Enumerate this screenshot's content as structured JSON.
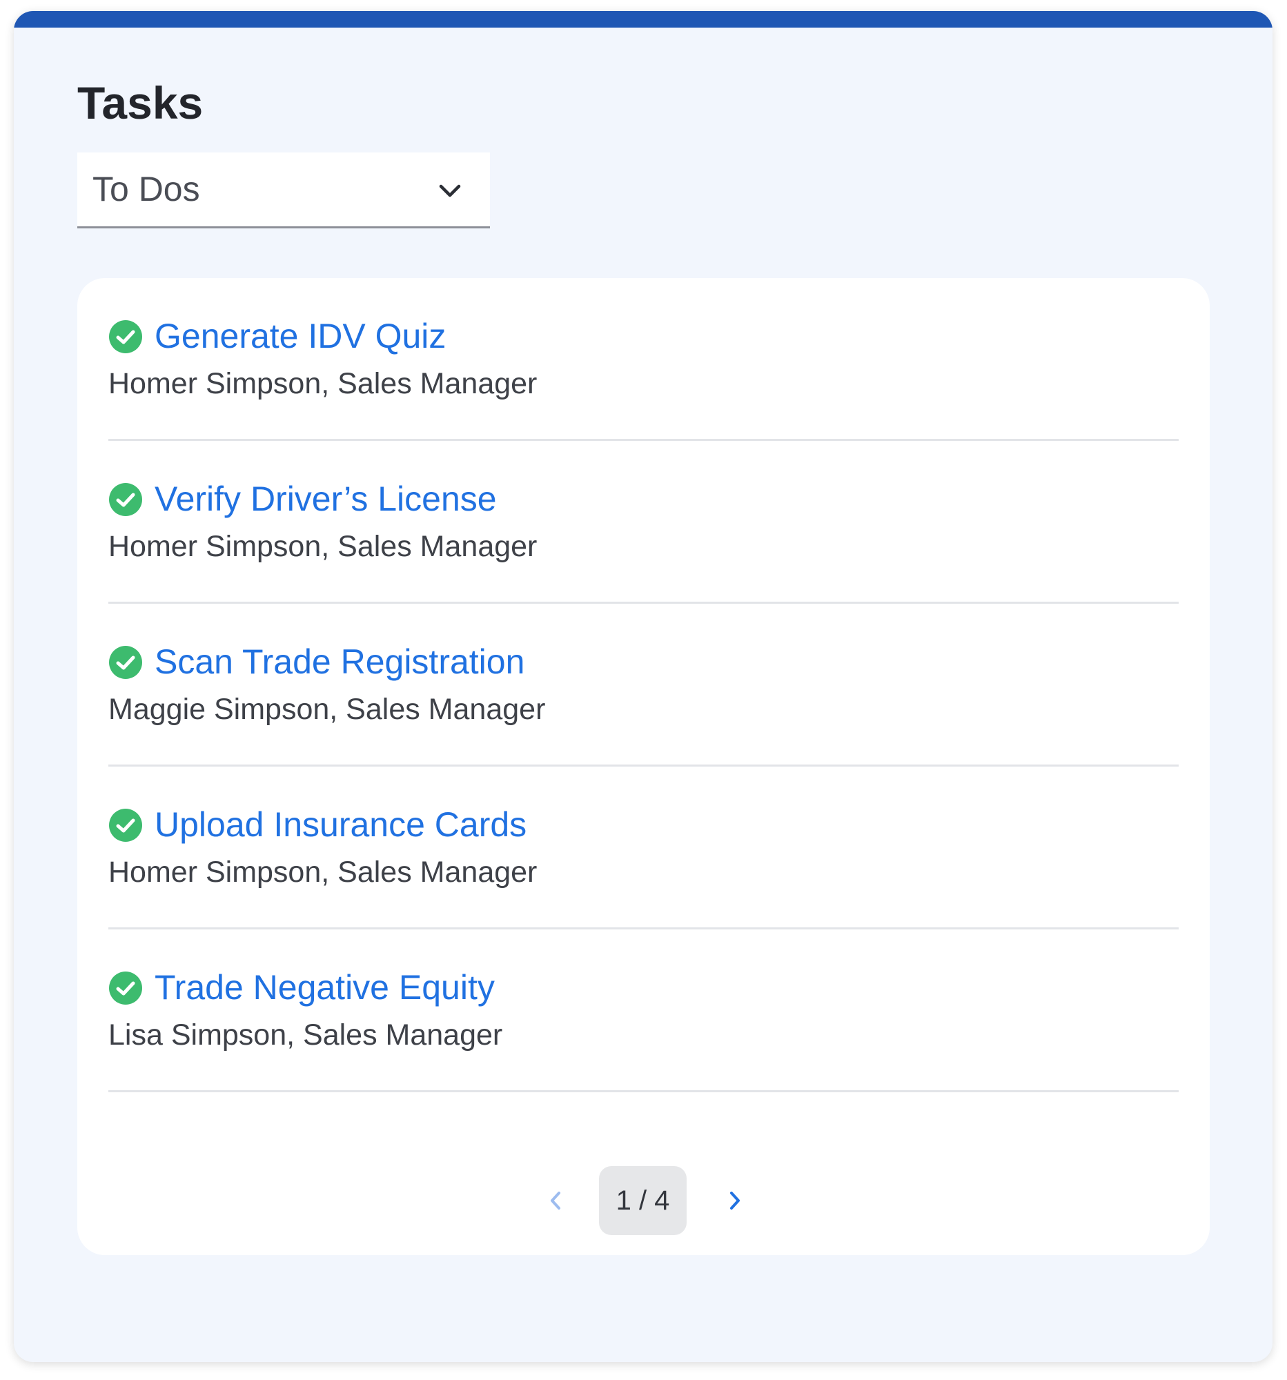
{
  "header": {
    "title": "Tasks"
  },
  "filter": {
    "selected": "To Dos"
  },
  "tasks": [
    {
      "title": "Generate IDV Quiz",
      "owner": "Homer Simpson, Sales Manager",
      "status": "complete"
    },
    {
      "title": "Verify Driver’s License",
      "owner": "Homer Simpson, Sales Manager",
      "status": "complete"
    },
    {
      "title": "Scan Trade Registration",
      "owner": "Maggie Simpson, Sales Manager",
      "status": "complete"
    },
    {
      "title": "Upload Insurance Cards",
      "owner": "Homer Simpson, Sales Manager",
      "status": "complete"
    },
    {
      "title": "Trade Negative Equity",
      "owner": "Lisa Simpson, Sales Manager",
      "status": "complete"
    }
  ],
  "pagination": {
    "label": "1 / 4"
  },
  "colors": {
    "accent_bar": "#1f57b4",
    "link": "#2071e1",
    "check": "#3dbb6e",
    "panel_bg": "#f2f6fd"
  }
}
